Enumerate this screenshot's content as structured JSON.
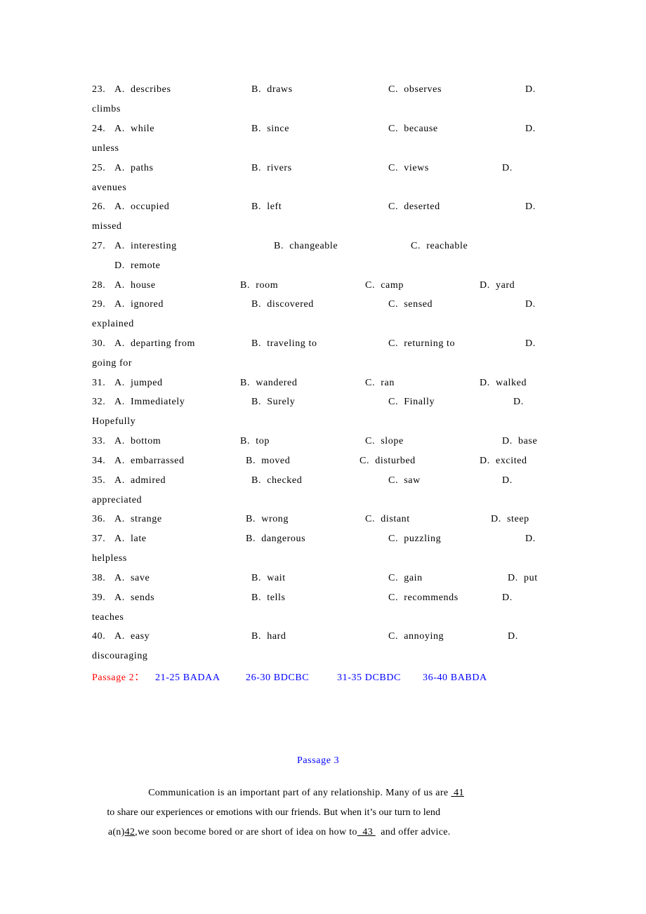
{
  "questions": [
    {
      "num": "23.",
      "a": "A.  describes",
      "b": "B.  draws",
      "c": "C.  observes",
      "d": "D.",
      "d_wrap": "climbs"
    },
    {
      "num": "24.",
      "a": "A.  while",
      "b": "B.  since",
      "c": "C.  because",
      "d": "D.",
      "d_wrap": "unless"
    },
    {
      "num": "25.",
      "a": "A.  paths",
      "b": "B.  rivers",
      "c": "C.  views",
      "d": "D.",
      "d_wrap": "avenues"
    },
    {
      "num": "26.",
      "a": "A.  occupied",
      "b": "B.  left",
      "c": "C.  deserted",
      "d": "D.",
      "d_wrap": "missed"
    },
    {
      "num": "27.",
      "a": "A.  interesting",
      "b": "B.  changeable",
      "c": "C.  reachable",
      "d": "D.  remote"
    },
    {
      "num": "28.",
      "a": "A.  house",
      "b": "B.  room",
      "c": "C.  camp",
      "d": "D.  yard"
    },
    {
      "num": "29.",
      "a": "A.  ignored",
      "b": "B.  discovered",
      "c": "C.  sensed",
      "d": "D.",
      "d_wrap": "explained"
    },
    {
      "num": "30.",
      "a": "A.  departing from",
      "b": "B.  traveling to",
      "c": "C.  returning to",
      "d": "D.",
      "d_wrap": "going for"
    },
    {
      "num": "31.",
      "a": "A.  jumped",
      "b": "B.  wandered",
      "c": "C.  ran",
      "d": "D.  walked"
    },
    {
      "num": "32.",
      "a": "A.  Immediately",
      "b": "B.  Surely",
      "c": "C.  Finally",
      "d": "D.",
      "d_wrap": "Hopefully"
    },
    {
      "num": "33.",
      "a": "A.  bottom",
      "b": "B.  top",
      "c": "C.  slope",
      "d": "D.  base"
    },
    {
      "num": "34.",
      "a": "A.  embarrassed",
      "b": "B.  moved",
      "c": "C.  disturbed",
      "d": "D.  excited"
    },
    {
      "num": "35.",
      "a": "A.  admired",
      "b": "B.  checked",
      "c": "C.  saw",
      "d": "D.",
      "d_wrap": "appreciated"
    },
    {
      "num": "36.",
      "a": "A.  strange",
      "b": "B.  wrong",
      "c": "C.  distant",
      "d": "D.  steep"
    },
    {
      "num": "37.",
      "a": "A.  late",
      "b": "B.  dangerous",
      "c": "C.  puzzling",
      "d": "D.",
      "d_wrap": "helpless"
    },
    {
      "num": "38.",
      "a": "A.  save",
      "b": "B.  wait",
      "c": "C.  gain",
      "d": "D.  put"
    },
    {
      "num": "39.",
      "a": "A.  sends",
      "b": "B.  tells",
      "c": "C.  recommends",
      "d": "D.",
      "d_wrap": "teaches"
    },
    {
      "num": "40.",
      "a": "A.  easy",
      "b": "B.  hard",
      "c": "C.  annoying",
      "d": "D.",
      "d_wrap": "discouraging"
    }
  ],
  "answers": {
    "label": "Passage 2：",
    "groups": [
      "21-25 BADAA",
      "26-30 BDCBC",
      "31-35 DCBDC",
      "36-40 BABDA"
    ]
  },
  "passage3": {
    "title": "Passage 3",
    "line1_pre": "Communication is an important part of any relationship. Many of us are ",
    "blank41": " 41",
    "line2": "to share our experiences or emotions with our friends. But when it’s our turn to lend",
    "line3_pre": "a(n)",
    "blank42": "42",
    "line3_mid": ",we soon become bored or are short of idea on how to",
    "blank43": "  43 ",
    "line3_post": "  and offer advice."
  },
  "colors": {
    "answer_label": "#ff0000",
    "answer_groups": "#0000ff",
    "passage_title": "#0000ff",
    "text": "#000000"
  }
}
